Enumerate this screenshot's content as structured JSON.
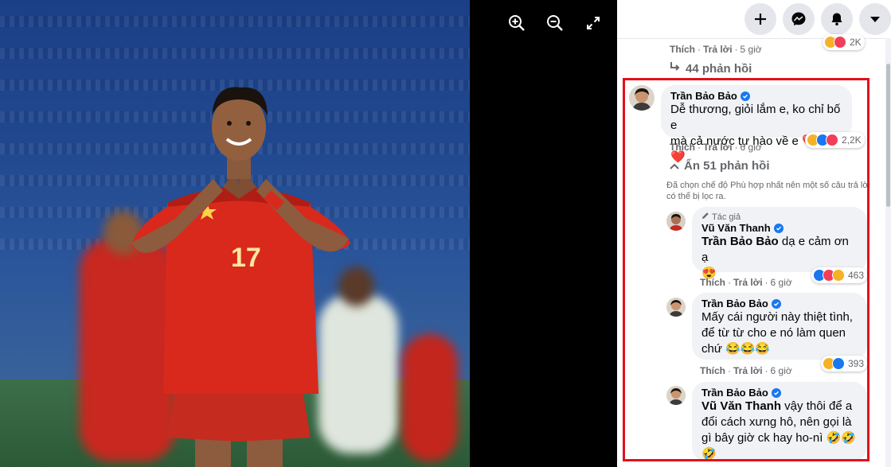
{
  "viewer": {
    "zoom_in_icon": "zoom-in-icon",
    "zoom_out_icon": "zoom-out-icon",
    "fullscreen_icon": "fullscreen-icon"
  },
  "photo": {
    "jersey_number": "17"
  },
  "header": {
    "create_icon": "plus-icon",
    "messenger_icon": "messenger-icon",
    "notifications_icon": "bell-icon",
    "account_icon": "caret-down-icon"
  },
  "prev_comment": {
    "like": "Thích",
    "reply": "Trả lời",
    "time": "5 giờ",
    "reaction_count": "2K"
  },
  "prev_replies": {
    "label": "44 phản hồi"
  },
  "main_comment": {
    "author": "Trần Bảo Bảo",
    "text_line1": "Dễ thương, giỏi lắm e, ko chỉ bố e",
    "text_line2": "mà cả nước tự hào về e ❤️❤️❤️",
    "like": "Thích",
    "reply": "Trả lời",
    "time": "6 giờ",
    "reaction_count": "2,2K",
    "hide_replies": "Ẩn 51 phản hồi",
    "filter_note_line1": "Đã chọn chế độ Phù hợp nhất nên một số câu trả lời",
    "filter_note_line2": "có thể bị lọc ra."
  },
  "replies": [
    {
      "author_tag": "Tác giả",
      "author": "Vũ Văn Thanh",
      "mention": "Trần Bảo Bảo",
      "text_line1": " dạ e cảm ơn ạ",
      "text_line2": "😍",
      "like": "Thích",
      "reply": "Trả lời",
      "time": "6 giờ",
      "reaction_count": "463"
    },
    {
      "author": "Trần Bảo Bảo",
      "text_line1": "Mấy cái người này thiệt tình,",
      "text_line2": "để từ từ cho e nó làm quen",
      "text_line3": "chứ 😂😂😂",
      "like": "Thích",
      "reply": "Trả lời",
      "time": "6 giờ",
      "reaction_count": "393"
    },
    {
      "author": "Trần Bảo Bảo",
      "mention": "Vũ Văn Thanh",
      "text_line1": " vậy thôi để a",
      "text_line2": "đổi cách xưng hô, nên gọi là",
      "text_line3": "gì bây giờ ck hay ho-nì 🤣🤣",
      "text_line4": "🤣"
    }
  ],
  "colors": {
    "highlight": "#e3101d",
    "verified": "#1877f2",
    "bubble": "#f0f2f5"
  }
}
